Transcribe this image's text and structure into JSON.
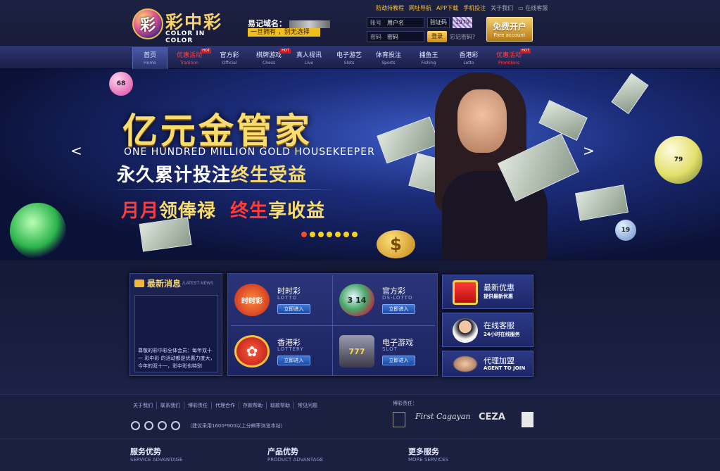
{
  "brand": {
    "icon_char": "彩",
    "name_cn": "彩中彩",
    "name_en": "COLOR IN COLOR"
  },
  "domain": {
    "label": "易记域名：",
    "slogan": "一旦拥有 ，别无选择"
  },
  "top_links": [
    "防劫持教程",
    "网址导航",
    "APP下载",
    "手机投注",
    "关于我们",
    "在线客服"
  ],
  "login": {
    "account_label": "账号",
    "account_placeholder": "用户名",
    "password_label": "密码",
    "password_placeholder": "密码",
    "captcha_label": "验证码",
    "captcha_value": "1979",
    "login_button": "登录",
    "forgot": "忘记密码?"
  },
  "signup": {
    "cn": "免费开户",
    "en": "Free account"
  },
  "nav": [
    {
      "cn": "首页",
      "en": "Home"
    },
    {
      "cn": "优惠活动",
      "en": "Tradition",
      "hot": "HOT"
    },
    {
      "cn": "官方彩",
      "en": "Official"
    },
    {
      "cn": "棋牌游戏",
      "en": "Chess",
      "hot": "HOT"
    },
    {
      "cn": "真人视讯",
      "en": "Live"
    },
    {
      "cn": "电子游艺",
      "en": "Slots"
    },
    {
      "cn": "体育投注",
      "en": "Sports"
    },
    {
      "cn": "捕鱼王",
      "en": "Fishing"
    },
    {
      "cn": "香港彩",
      "en": "Lotto"
    },
    {
      "cn": "优惠活动",
      "en": "Promtions",
      "hot": "HOT"
    }
  ],
  "banner": {
    "title": "亿元金管家",
    "en": "ONE HUNDRED MILLION GOLD HOUSEKEEPER",
    "sub1_a": "永久累计投注",
    "sub1_b": "终生受益",
    "sub2_a": "月月",
    "sub2_b": "领俸禄",
    "sub2_c": "终生",
    "sub2_d": "享收益",
    "prev": "<",
    "next": ">",
    "coin": "$",
    "ball_numbers": [
      "68",
      "79",
      "19"
    ],
    "slides": 7,
    "active_slide": 1
  },
  "news": {
    "title": "最新消息",
    "en": "/LATEST NEWS",
    "body": "尊敬的彩中彩全体会员：每年双十一 彩中彩 的活动都是优惠力度大，今年的双十一，彩中彩也特别"
  },
  "games": [
    {
      "name": "时时彩",
      "en": "LOTTO",
      "enter": "立即进入",
      "icon": "时时彩",
      "color": "#e43b2c"
    },
    {
      "name": "官方彩",
      "en": "DS-LOTTO",
      "enter": "立即进入",
      "icon": "3 14",
      "color": "#2d8a4a"
    },
    {
      "name": "香港彩",
      "en": "LOTTERY",
      "enter": "立即进入",
      "icon": "✿",
      "color": "#d8282a"
    },
    {
      "name": "电子游戏",
      "en": "SLOT",
      "enter": "立即进入",
      "icon": "777",
      "color": "#6c6c80"
    }
  ],
  "side": [
    {
      "title": "最新优惠",
      "sub": "提供最新优惠"
    },
    {
      "title": "在线客服",
      "sub": "24小时在线服务"
    },
    {
      "title": "代理加盟",
      "sub": "AGENT TO JOIN"
    }
  ],
  "footer": {
    "links": [
      "关于我们",
      "联系我们",
      "博彩责任",
      "代理合作",
      "存款帮助",
      "取款帮助",
      "常见问题"
    ],
    "browser_note": "（建议采用1600*900以上分辨率浏览本站）",
    "responsibility": "博彩责任：",
    "licenses": [
      "First Cagayan",
      "CEZA"
    ],
    "cols": [
      {
        "t": "服务优势",
        "e": "SERVICE ADVANTAGE"
      },
      {
        "t": "产品优势",
        "e": "PRODUCT ADVANTAGE"
      },
      {
        "t": "更多服务",
        "e": "MORE SERVICES"
      }
    ]
  }
}
